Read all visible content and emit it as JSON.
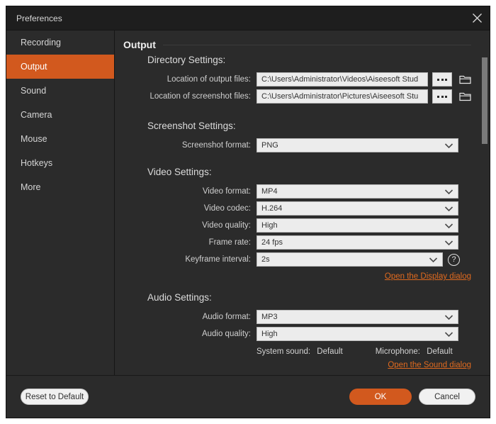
{
  "window": {
    "title": "Preferences",
    "close_icon": "close-icon"
  },
  "colors": {
    "accent": "#d2591e",
    "link": "#e06a1f",
    "panel_bg": "#2b2b2b",
    "titlebar_bg": "#1e1e1e",
    "field_bg": "#ececec"
  },
  "sidebar": {
    "items": [
      {
        "label": "Recording",
        "active": false
      },
      {
        "label": "Output",
        "active": true
      },
      {
        "label": "Sound",
        "active": false
      },
      {
        "label": "Camera",
        "active": false
      },
      {
        "label": "Mouse",
        "active": false
      },
      {
        "label": "Hotkeys",
        "active": false
      },
      {
        "label": "More",
        "active": false
      }
    ]
  },
  "main": {
    "page_title": "Output",
    "directory": {
      "heading": "Directory Settings:",
      "output_files": {
        "label": "Location of output files:",
        "value": "C:\\Users\\Administrator\\Videos\\Aiseesoft Stud",
        "browse_label": "...",
        "folder_icon": "folder-icon"
      },
      "screenshot_files": {
        "label": "Location of screenshot files:",
        "value": "C:\\Users\\Administrator\\Pictures\\Aiseesoft Stu",
        "browse_label": "...",
        "folder_icon": "folder-icon"
      }
    },
    "screenshot": {
      "heading": "Screenshot Settings:",
      "format": {
        "label": "Screenshot format:",
        "value": "PNG"
      }
    },
    "video": {
      "heading": "Video Settings:",
      "fields": [
        {
          "label": "Video format:",
          "value": "MP4"
        },
        {
          "label": "Video codec:",
          "value": "H.264"
        },
        {
          "label": "Video quality:",
          "value": "High"
        },
        {
          "label": "Frame rate:",
          "value": "24 fps"
        }
      ],
      "keyframe": {
        "label": "Keyframe interval:",
        "value": "2s",
        "help_label": "?"
      },
      "display_link": "Open the Display dialog"
    },
    "audio": {
      "heading": "Audio Settings:",
      "format": {
        "label": "Audio format:",
        "value": "MP3"
      },
      "quality": {
        "label": "Audio quality:",
        "value": "High"
      },
      "system_sound": {
        "label": "System sound:",
        "value": "Default"
      },
      "microphone": {
        "label": "Microphone:",
        "value": "Default"
      },
      "sound_link": "Open the Sound dialog"
    }
  },
  "footer": {
    "reset": "Reset to Default",
    "ok": "OK",
    "cancel": "Cancel"
  }
}
